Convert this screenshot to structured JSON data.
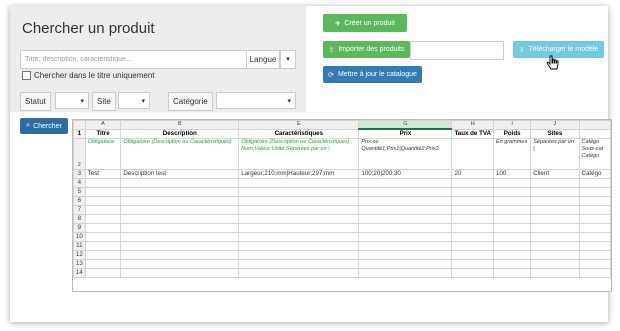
{
  "search": {
    "title": "Chercher un produit",
    "placeholder": "Titre, description, caractéristique...",
    "language_label": "Langue",
    "title_only_label": "Chercher dans le titre uniquement",
    "statut_label": "Statut",
    "site_label": "Site",
    "categorie_label": "Catégorie",
    "search_button": "Chercher"
  },
  "actions": {
    "create": "Créer un produit",
    "import": "Importer des produits",
    "download": "Télécharger le modèle",
    "update": "Mettre à jour le catalogue"
  },
  "sheet": {
    "columns": [
      "A",
      "B",
      "E",
      "G",
      "H",
      "I",
      "J",
      ""
    ],
    "headers": [
      "Titre",
      "Description",
      "Caractéristiques",
      "Prix",
      "Taux de TVA",
      "Poids",
      "Sites",
      ""
    ],
    "row2": [
      "Obligatoire",
      "Obligatoire (Description ou Caractéristiques)",
      "Obligatoire (Description ou Caractéristiques) Nom;Valeur;Unité Séparées par un |",
      "Prix ou Quantité1;Prix1|Quantité2;Prix2",
      "",
      "En grammes",
      "Séparées par un |",
      "Catégo Sous-cat Catégo"
    ],
    "row3": [
      "Test",
      "Description test",
      "Largeur;210;mm|Hauteur;297;mm",
      "100;20|200;30",
      "20",
      "100",
      "Client",
      "Catégo"
    ],
    "row_numbers": [
      "1",
      "2",
      "3",
      "4",
      "5",
      "6",
      "7",
      "8",
      "9",
      "10",
      "11",
      "12",
      "13",
      "14"
    ]
  }
}
